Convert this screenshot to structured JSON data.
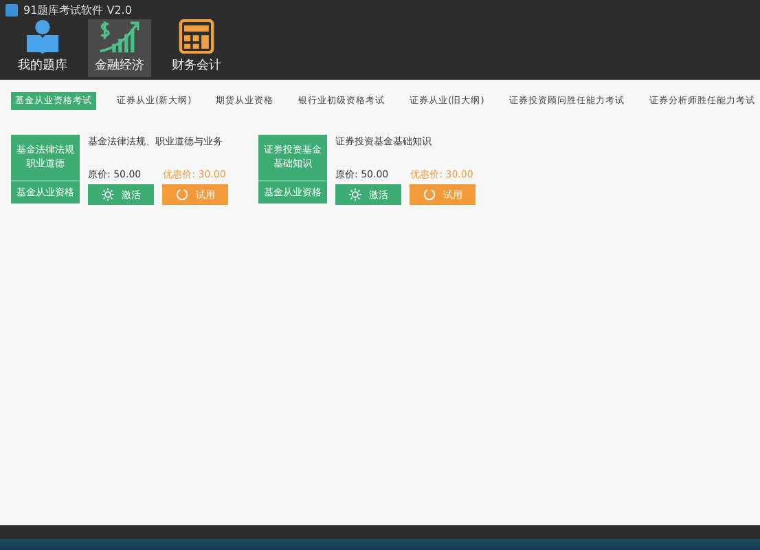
{
  "window": {
    "title": "91题库考试软件 V2.0"
  },
  "toolbar": [
    {
      "label": "我的题库",
      "kind": "reader",
      "selected": false
    },
    {
      "label": "金融经济",
      "kind": "growth",
      "selected": true
    },
    {
      "label": "财务会计",
      "kind": "calculator",
      "selected": false
    }
  ],
  "tabs": [
    {
      "label": "基金从业资格考试",
      "selected": true
    },
    {
      "label": "证券从业(新大纲)",
      "selected": false
    },
    {
      "label": "期货从业资格",
      "selected": false
    },
    {
      "label": "银行业初级资格考试",
      "selected": false
    },
    {
      "label": "证券从业(旧大纲)",
      "selected": false
    },
    {
      "label": "证券投资顾问胜任能力考试",
      "selected": false
    },
    {
      "label": "证券分析师胜任能力考试",
      "selected": false
    }
  ],
  "courses": [
    {
      "cover_title": "基金法律法规职业道德",
      "cover_subtitle": "基金从业资格",
      "name": "基金法律法规、职业道德与业务",
      "price_label": "原价:",
      "price": "50.00",
      "discount_label": "优惠价:",
      "discount": "30.00",
      "activate": "激活",
      "trial": "试用"
    },
    {
      "cover_title": "证券投资基金基础知识",
      "cover_subtitle": "基金从业资格",
      "name": "证券投资基金基础知识",
      "price_label": "原价:",
      "price": "50.00",
      "discount_label": "优惠价:",
      "discount": "30.00",
      "activate": "激活",
      "trial": "试用"
    }
  ]
}
